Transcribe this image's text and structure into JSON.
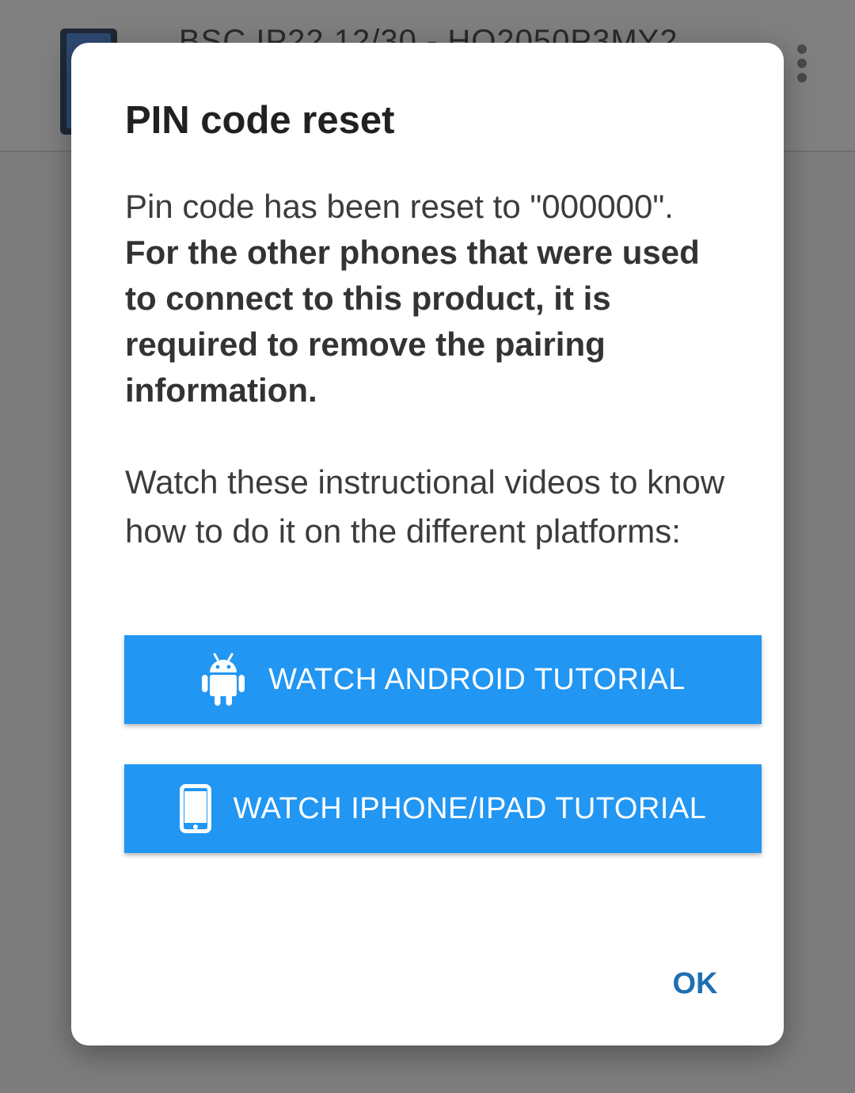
{
  "background": {
    "app_bar_title": "BSC IP22 12/30 - HQ2050P3MY2",
    "device_icon": "device-thumbnail",
    "menu_icon": "overflow-menu-icon"
  },
  "dialog": {
    "title": "PIN code reset",
    "body_plain": "Pin code has been reset to \"000000\".",
    "body_bold": "For the other phones that were used to connect to this product, it is required to remove the pairing information.",
    "instructions": "Watch these instructional videos to know how to do it on the different platforms:",
    "android_button": {
      "label": "WATCH ANDROID TUTORIAL",
      "icon": "android-icon"
    },
    "iphone_button": {
      "label": "WATCH IPHONE/IPAD TUTORIAL",
      "icon": "phone-icon"
    },
    "ok_label": "OK"
  },
  "colors": {
    "accent": "#2196f3",
    "ok_text": "#1e6fb3",
    "scrim": "#7d7d7d"
  }
}
